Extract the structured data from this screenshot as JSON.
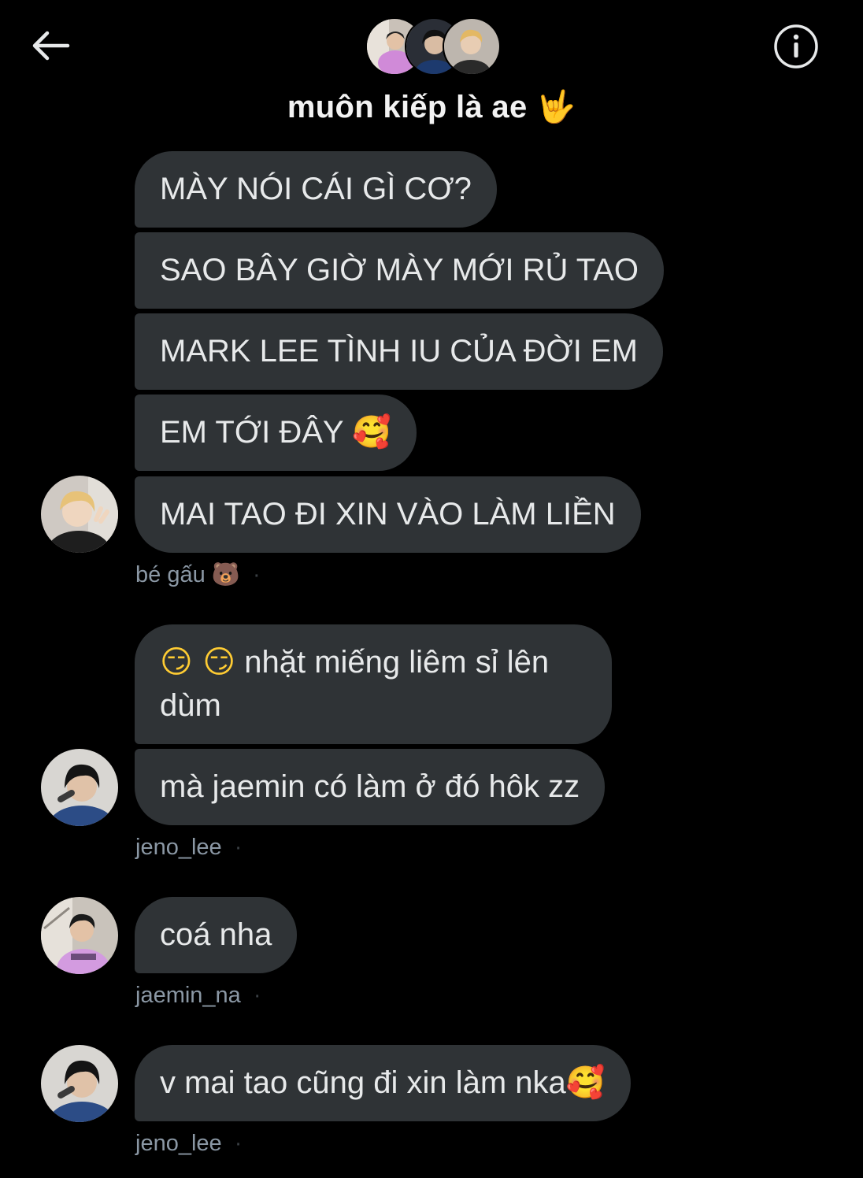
{
  "header": {
    "title": "muôn kiếp là ae",
    "title_emoji": "🤟",
    "back_icon": "arrow-left-icon",
    "info_icon": "info-circle-icon"
  },
  "messages": [
    {
      "text": "MÀY NÓI CÁI GÌ CƠ?"
    },
    {
      "text": "SAO BÂY GIỜ MÀY MỚI RỦ TAO"
    },
    {
      "text": "MARK LEE TÌNH IU CỦA ĐỜI EM"
    },
    {
      "text": "EM TỚI ĐÂY",
      "emoji": "🥰"
    },
    {
      "text": "MAI TAO ĐI XIN VÀO LÀM LIỀN"
    },
    {
      "emoji": "😏 😏",
      "text": "nhặt miếng liêm sỉ lên dùm"
    },
    {
      "text": "mà jaemin có làm ở đó hôk zz"
    },
    {
      "text": "coá nha"
    },
    {
      "text": "v mai tao cũng đi xin làm nka",
      "emoji": "🥰"
    }
  ],
  "senders": [
    {
      "name": "bé gấu",
      "emoji": "🐻"
    },
    {
      "name": "jeno_lee"
    },
    {
      "name": "jaemin_na"
    },
    {
      "name": "jeno_lee"
    }
  ],
  "colors": {
    "background": "#000000",
    "bubble": "#2f3336",
    "text": "#e7e9ea",
    "meta": "#8b98a5"
  }
}
